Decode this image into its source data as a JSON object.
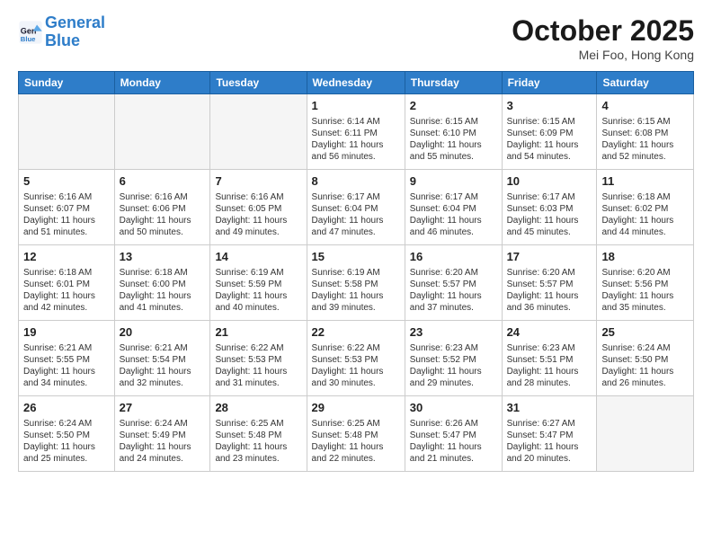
{
  "header": {
    "logo_line1": "General",
    "logo_line2": "Blue",
    "month": "October 2025",
    "location": "Mei Foo, Hong Kong"
  },
  "weekdays": [
    "Sunday",
    "Monday",
    "Tuesday",
    "Wednesday",
    "Thursday",
    "Friday",
    "Saturday"
  ],
  "weeks": [
    [
      {
        "day": "",
        "info": ""
      },
      {
        "day": "",
        "info": ""
      },
      {
        "day": "",
        "info": ""
      },
      {
        "day": "1",
        "info": "Sunrise: 6:14 AM\nSunset: 6:11 PM\nDaylight: 11 hours\nand 56 minutes."
      },
      {
        "day": "2",
        "info": "Sunrise: 6:15 AM\nSunset: 6:10 PM\nDaylight: 11 hours\nand 55 minutes."
      },
      {
        "day": "3",
        "info": "Sunrise: 6:15 AM\nSunset: 6:09 PM\nDaylight: 11 hours\nand 54 minutes."
      },
      {
        "day": "4",
        "info": "Sunrise: 6:15 AM\nSunset: 6:08 PM\nDaylight: 11 hours\nand 52 minutes."
      }
    ],
    [
      {
        "day": "5",
        "info": "Sunrise: 6:16 AM\nSunset: 6:07 PM\nDaylight: 11 hours\nand 51 minutes."
      },
      {
        "day": "6",
        "info": "Sunrise: 6:16 AM\nSunset: 6:06 PM\nDaylight: 11 hours\nand 50 minutes."
      },
      {
        "day": "7",
        "info": "Sunrise: 6:16 AM\nSunset: 6:05 PM\nDaylight: 11 hours\nand 49 minutes."
      },
      {
        "day": "8",
        "info": "Sunrise: 6:17 AM\nSunset: 6:04 PM\nDaylight: 11 hours\nand 47 minutes."
      },
      {
        "day": "9",
        "info": "Sunrise: 6:17 AM\nSunset: 6:04 PM\nDaylight: 11 hours\nand 46 minutes."
      },
      {
        "day": "10",
        "info": "Sunrise: 6:17 AM\nSunset: 6:03 PM\nDaylight: 11 hours\nand 45 minutes."
      },
      {
        "day": "11",
        "info": "Sunrise: 6:18 AM\nSunset: 6:02 PM\nDaylight: 11 hours\nand 44 minutes."
      }
    ],
    [
      {
        "day": "12",
        "info": "Sunrise: 6:18 AM\nSunset: 6:01 PM\nDaylight: 11 hours\nand 42 minutes."
      },
      {
        "day": "13",
        "info": "Sunrise: 6:18 AM\nSunset: 6:00 PM\nDaylight: 11 hours\nand 41 minutes."
      },
      {
        "day": "14",
        "info": "Sunrise: 6:19 AM\nSunset: 5:59 PM\nDaylight: 11 hours\nand 40 minutes."
      },
      {
        "day": "15",
        "info": "Sunrise: 6:19 AM\nSunset: 5:58 PM\nDaylight: 11 hours\nand 39 minutes."
      },
      {
        "day": "16",
        "info": "Sunrise: 6:20 AM\nSunset: 5:57 PM\nDaylight: 11 hours\nand 37 minutes."
      },
      {
        "day": "17",
        "info": "Sunrise: 6:20 AM\nSunset: 5:57 PM\nDaylight: 11 hours\nand 36 minutes."
      },
      {
        "day": "18",
        "info": "Sunrise: 6:20 AM\nSunset: 5:56 PM\nDaylight: 11 hours\nand 35 minutes."
      }
    ],
    [
      {
        "day": "19",
        "info": "Sunrise: 6:21 AM\nSunset: 5:55 PM\nDaylight: 11 hours\nand 34 minutes."
      },
      {
        "day": "20",
        "info": "Sunrise: 6:21 AM\nSunset: 5:54 PM\nDaylight: 11 hours\nand 32 minutes."
      },
      {
        "day": "21",
        "info": "Sunrise: 6:22 AM\nSunset: 5:53 PM\nDaylight: 11 hours\nand 31 minutes."
      },
      {
        "day": "22",
        "info": "Sunrise: 6:22 AM\nSunset: 5:53 PM\nDaylight: 11 hours\nand 30 minutes."
      },
      {
        "day": "23",
        "info": "Sunrise: 6:23 AM\nSunset: 5:52 PM\nDaylight: 11 hours\nand 29 minutes."
      },
      {
        "day": "24",
        "info": "Sunrise: 6:23 AM\nSunset: 5:51 PM\nDaylight: 11 hours\nand 28 minutes."
      },
      {
        "day": "25",
        "info": "Sunrise: 6:24 AM\nSunset: 5:50 PM\nDaylight: 11 hours\nand 26 minutes."
      }
    ],
    [
      {
        "day": "26",
        "info": "Sunrise: 6:24 AM\nSunset: 5:50 PM\nDaylight: 11 hours\nand 25 minutes."
      },
      {
        "day": "27",
        "info": "Sunrise: 6:24 AM\nSunset: 5:49 PM\nDaylight: 11 hours\nand 24 minutes."
      },
      {
        "day": "28",
        "info": "Sunrise: 6:25 AM\nSunset: 5:48 PM\nDaylight: 11 hours\nand 23 minutes."
      },
      {
        "day": "29",
        "info": "Sunrise: 6:25 AM\nSunset: 5:48 PM\nDaylight: 11 hours\nand 22 minutes."
      },
      {
        "day": "30",
        "info": "Sunrise: 6:26 AM\nSunset: 5:47 PM\nDaylight: 11 hours\nand 21 minutes."
      },
      {
        "day": "31",
        "info": "Sunrise: 6:27 AM\nSunset: 5:47 PM\nDaylight: 11 hours\nand 20 minutes."
      },
      {
        "day": "",
        "info": ""
      }
    ]
  ]
}
